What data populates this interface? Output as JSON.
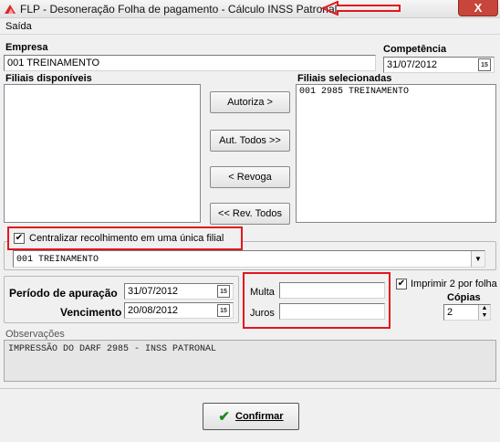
{
  "window": {
    "title": "FLP - Desoneração Folha de pagamento - Cálculo INSS Patronal",
    "close_glyph": "X"
  },
  "menu": {
    "items": [
      {
        "label": "Saída"
      }
    ]
  },
  "empresa": {
    "label": "Empresa",
    "value": "001 TREINAMENTO"
  },
  "competencia": {
    "label": "Competência",
    "value": "31/07/2012"
  },
  "filiais_disponiveis": {
    "label": "Filiais disponíveis",
    "items": []
  },
  "filiais_selecionadas": {
    "label": "Filiais selecionadas",
    "items": [
      "001 2985  TREINAMENTO"
    ]
  },
  "buttons": {
    "autoriza": "Autoriza >",
    "aut_todos": "Aut. Todos >>",
    "revoga": "< Revoga",
    "rev_todos": "<< Rev. Todos"
  },
  "centralizar": {
    "label": "Centralizar recolhimento em uma única filial",
    "checked": true,
    "selected": "001  TREINAMENTO"
  },
  "periodo": {
    "label": "Período de apuração",
    "value": "31/07/2012"
  },
  "vencimento": {
    "label": "Vencimento",
    "value": "20/08/2012"
  },
  "multa": {
    "label": "Multa",
    "value": ""
  },
  "juros": {
    "label": "Juros",
    "value": ""
  },
  "imprimir": {
    "label": "Imprimir 2 por folha",
    "checked": true
  },
  "copias": {
    "label": "Cópias",
    "value": "2"
  },
  "observacoes": {
    "label": "Observações",
    "value": "IMPRESSÃO DO DARF 2985 - INSS PATRONAL"
  },
  "confirmar": {
    "label": "Confirmar"
  },
  "icons": {
    "calendar": "15",
    "check": "✔",
    "dropdown": "▼",
    "spin_up": "▲",
    "spin_down": "▼"
  },
  "colors": {
    "annotation_red": "#e2161e",
    "confirm_green": "#1e8a1e"
  }
}
